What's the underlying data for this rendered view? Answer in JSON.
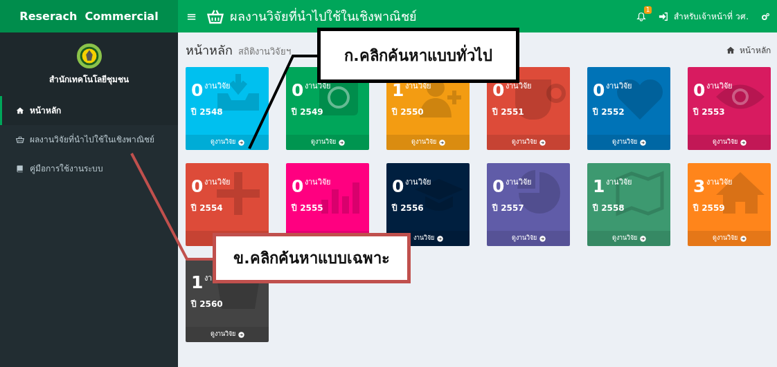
{
  "sidebar": {
    "brand": "Reserach  Commercial",
    "org_name": "สำนักเทคโนโลยีชุมชน",
    "items": [
      {
        "label": "หน้าหลัก",
        "selected": true
      },
      {
        "label": "ผลงานวิจัยที่นำไปใช้ในเชิงพาณิชย์",
        "selected": false
      },
      {
        "label": "คู่มือการใช้งานระบบ",
        "selected": false
      }
    ]
  },
  "header": {
    "menu_toggle": "≡",
    "title": "ผลงานวิจัยที่นำไปใช้ในเชิงพาณิชย์",
    "notification_count": "1",
    "login": "สำหรับเจ้าหน้าที่ วศ."
  },
  "page": {
    "title": "หน้าหลัก",
    "subtitle": "สถิติงานวิจัยฯ",
    "breadcrumb": "หน้าหลัก"
  },
  "tiles": [
    {
      "count": "0",
      "label": "งานวิจัย",
      "year": "ปี 2548",
      "link": "ดูงานวิจัย",
      "color": "#00c0ef"
    },
    {
      "count": "0",
      "label": "งานวิจัย",
      "year": "ปี 2549",
      "link": "ดูงานวิจัย",
      "color": "#00a65a"
    },
    {
      "count": "1",
      "label": "งานวิจัย",
      "year": "ปี 2550",
      "link": "ดูงานวิจัย",
      "color": "#f39c12"
    },
    {
      "count": "0",
      "label": "งานวิจัย",
      "year": "ปี 2551",
      "link": "ดูงานวิจัย",
      "color": "#dd4b39"
    },
    {
      "count": "0",
      "label": "งานวิจัย",
      "year": "ปี 2552",
      "link": "ดูงานวิจัย",
      "color": "#0073b7"
    },
    {
      "count": "0",
      "label": "งานวิจัย",
      "year": "ปี 2553",
      "link": "ดูงานวิจัย",
      "color": "#d81b60"
    },
    {
      "count": "0",
      "label": "งานวิจัย",
      "year": "ปี 2554",
      "color": "#dd4b39"
    },
    {
      "count": "0",
      "label": "งานวิจัย",
      "year": "ปี 2555",
      "color": "#ff0080"
    },
    {
      "count": "0",
      "label": "งานวิจัย",
      "year": "ปี 2556",
      "link": "งานวิจัย",
      "color": "#001f3f"
    },
    {
      "count": "0",
      "label": "งานวิจัย",
      "year": "ปี 2557",
      "link": "ดูงานวิจัย",
      "color": "#605ca8"
    },
    {
      "count": "1",
      "label": "งานวิจัย",
      "year": "ปี 2558",
      "link": "ดูงานวิจัย",
      "color": "#3d9970"
    },
    {
      "count": "3",
      "label": "งานวิจัย",
      "year": "ปี 2559",
      "link": "ดูงานวิจัย",
      "color": "#ff851b"
    },
    {
      "count": "1",
      "label": "งา",
      "year": "ปี 2560",
      "link": "ดูงานวิจัย",
      "color": "#444444"
    }
  ],
  "callouts": [
    {
      "text": "ก.คลิกค้นหาแบบทั่วไป",
      "color": "#000000"
    },
    {
      "text": "ข.คลิกค้นหาแบบเฉพาะ",
      "color": "#c0504d"
    }
  ]
}
